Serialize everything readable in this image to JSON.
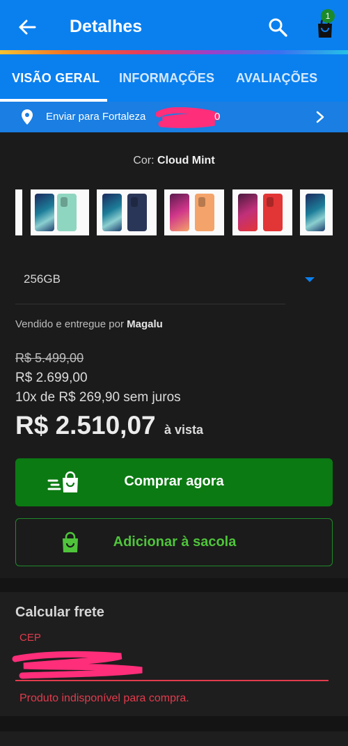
{
  "header": {
    "title": "Detalhes",
    "cart_count": "1",
    "icons": {
      "back": "arrow-left-icon",
      "search": "search-icon",
      "cart": "shopping-bag-icon"
    }
  },
  "tabs": [
    {
      "label": "VISÃO GERAL",
      "active": true
    },
    {
      "label": "INFORMAÇÕES",
      "active": false
    },
    {
      "label": "AVALIAÇÕES",
      "active": false
    }
  ],
  "shipping": {
    "text": "Enviar para Fortaleza",
    "suffix": "0",
    "icons": {
      "location": "location-pin-icon",
      "chevron": "chevron-right-icon"
    }
  },
  "product": {
    "color_label": "Cor:",
    "color_value": "Cloud Mint",
    "variants": [
      {
        "color": "#8fd6c0",
        "selected": true
      },
      {
        "color": "#2a3658",
        "selected": false
      },
      {
        "color": "#f4a36a",
        "selected": false
      },
      {
        "color": "#e23535",
        "selected": false
      },
      {
        "color": "#9cc0e6",
        "selected": false
      }
    ],
    "storage": "256GB",
    "seller_prefix": "Vendido e entregue por",
    "seller_name": "Magalu"
  },
  "pricing": {
    "old_price": "R$ 5.499,00",
    "price": "R$ 2.699,00",
    "installments": "10x de R$ 269,90 sem juros",
    "cash_price": "R$ 2.510,07",
    "cash_suffix": "à vista"
  },
  "actions": {
    "buy_now": "Comprar agora",
    "add_to_bag": "Adicionar à sacola"
  },
  "freight": {
    "title": "Calcular frete",
    "cep_label": "CEP",
    "error": "Produto indisponível para compra."
  },
  "colors": {
    "primary": "#0a80ef",
    "buy_green": "#0b7a12",
    "add_green": "#4fc43b",
    "error_red": "#e33b4d",
    "background": "#1b1b1b"
  }
}
